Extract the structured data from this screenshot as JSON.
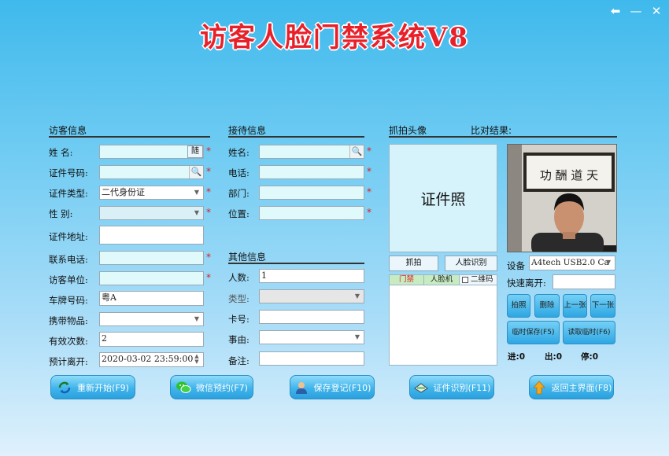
{
  "title": "访客人脸门禁系统V8",
  "window": {
    "back": "⬅",
    "minimize": "—",
    "close": "✕"
  },
  "visitor": {
    "section": "访客信息",
    "name_label": "姓    名:",
    "random_btn": "随",
    "id_no_label": "证件号码:",
    "id_type_label": "证件类型:",
    "id_type_value": "二代身份证",
    "gender_label": "性    别:",
    "address_label": "证件地址:",
    "phone_label": "联系电话:",
    "company_label": "访客单位:",
    "plate_label": "车牌号码:",
    "plate_value": "粤A",
    "items_label": "携带物品:",
    "times_label": "有效次数:",
    "times_value": "2",
    "leave_label": "预计离开:",
    "leave_value": "2020-03-02 23:59:00"
  },
  "reception": {
    "section": "接待信息",
    "name_label": "姓名:",
    "phone_label": "电话:",
    "dept_label": "部门:",
    "pos_label": "位置:"
  },
  "other": {
    "section": "其他信息",
    "count_label": "人数:",
    "count_value": "1",
    "type_label": "类型:",
    "card_label": "卡号:",
    "reason_label": "事由:",
    "note_label": "备注:"
  },
  "capture": {
    "section": "抓拍头像",
    "compare": "比对结果:",
    "id_photo": "证件照",
    "snap_btn": "抓拍",
    "face_btn": "人脸识别",
    "tab_door": "门禁",
    "tab_face": "人脸机",
    "qr_label": "二维码",
    "calligraphy": "功 酬 道 天"
  },
  "device": {
    "label": "设备",
    "value": "A4tech USB2.0 Ca",
    "quick_leave": "快速离开:",
    "photo_btn": "拍照",
    "delete_btn": "删除",
    "prev_btn": "上一张",
    "next_btn": "下一张",
    "tmp_save_btn": "临时保存(F5)",
    "tmp_read_btn": "读取临时(F6)",
    "in_label": "进:0",
    "out_label": "出:0",
    "stay_label": "停:0"
  },
  "actions": {
    "restart": "重新开始(F9)",
    "wechat": "微信预约(F7)",
    "save": "保存登记(F10)",
    "idscan": "证件识别(F11)",
    "home": "返回主界面(F8)"
  },
  "colors": {
    "title": "#e8202a",
    "background": "#6bcaf2",
    "button": "#40b4eb",
    "required": "#e02020"
  }
}
